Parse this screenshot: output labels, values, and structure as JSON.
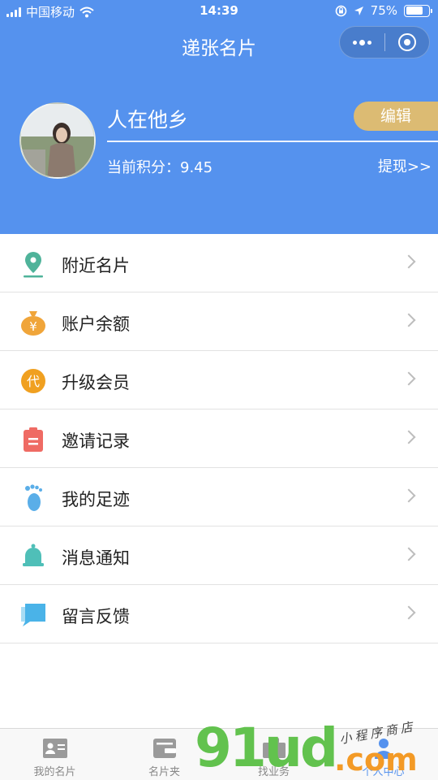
{
  "status_bar": {
    "carrier": "中国移动",
    "time": "14:39",
    "battery": "75%",
    "battery_level": 0.75
  },
  "header": {
    "title": "递张名片",
    "user_name": "人在他乡",
    "edit_label": "编辑",
    "points_text": "当前积分：9.45",
    "withdraw_label": "提现>>"
  },
  "menu": {
    "items": [
      {
        "label": "附近名片",
        "icon": "location-pin-icon",
        "color": "#4fb39a"
      },
      {
        "label": "账户余额",
        "icon": "money-bag-icon",
        "color": "#f0a53a"
      },
      {
        "label": "升级会员",
        "icon": "dai-badge-icon",
        "icon_text": "代",
        "color": "#f0a020"
      },
      {
        "label": "邀请记录",
        "icon": "clipboard-icon",
        "color": "#ef6b64"
      },
      {
        "label": "我的足迹",
        "icon": "footprint-icon",
        "color": "#5aaee8"
      },
      {
        "label": "消息通知",
        "icon": "bell-icon",
        "color": "#4fbfb8"
      },
      {
        "label": "留言反馈",
        "icon": "chat-bubbles-icon",
        "color": "#4ab3e8"
      }
    ]
  },
  "tab_bar": {
    "tabs": [
      {
        "label": "我的名片",
        "icon": "id-card-icon"
      },
      {
        "label": "名片夹",
        "icon": "wallet-icon"
      },
      {
        "label": "找业务",
        "icon": "briefcase-icon"
      },
      {
        "label": "个人中心",
        "icon": "person-icon",
        "active": true
      }
    ]
  },
  "watermark": {
    "number": "91ud",
    "domain": ".com",
    "tagline": "小程序商店"
  },
  "colors": {
    "header_blue": "#5592ee",
    "edit_gold": "#dcbb73",
    "watermark_green": "#62c24e",
    "watermark_orange": "#f39a26"
  }
}
